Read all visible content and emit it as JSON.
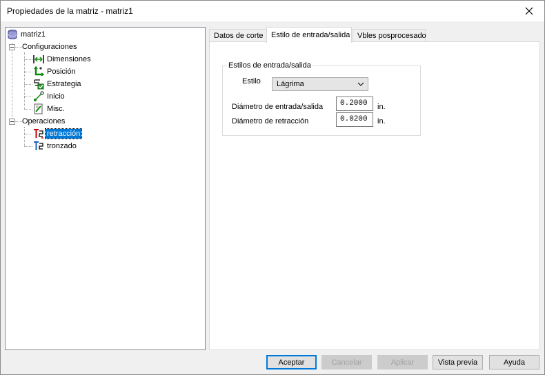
{
  "window": {
    "title": "Propiedades de la matriz - matriz1"
  },
  "tree": {
    "root": "matriz1",
    "configuraciones": {
      "label": "Configuraciones",
      "children": [
        "Dimensiones",
        "Posición",
        "Estrategia",
        "Inicio",
        "Misc."
      ]
    },
    "operaciones": {
      "label": "Operaciones",
      "children": [
        "retracción",
        "tronzado"
      ],
      "selected": "retracción"
    }
  },
  "tabs": [
    {
      "label": "Datos de corte",
      "active": false
    },
    {
      "label": "Estilo de entrada/salida",
      "active": true
    },
    {
      "label": "Vbles posprocesado",
      "active": false
    }
  ],
  "group": {
    "title": "Estilos de entrada/salida",
    "estilo_label": "Estilo",
    "estilo_value": "Lágrima",
    "diametro_entrada_label": "Diámetro de entrada/salida",
    "diametro_entrada_value": "0.2000",
    "diametro_retraccion_label": "Diámetro de retracción",
    "diametro_retraccion_value": "0.0200",
    "unit": "in."
  },
  "buttons": {
    "aceptar": "Aceptar",
    "cancelar": "Cancelar",
    "aplicar": "Aplicar",
    "vista_previa": "Vista previa",
    "ayuda": "Ayuda"
  },
  "colors": {
    "selection": "#0078d7",
    "default_button_border": "#0078d7"
  }
}
